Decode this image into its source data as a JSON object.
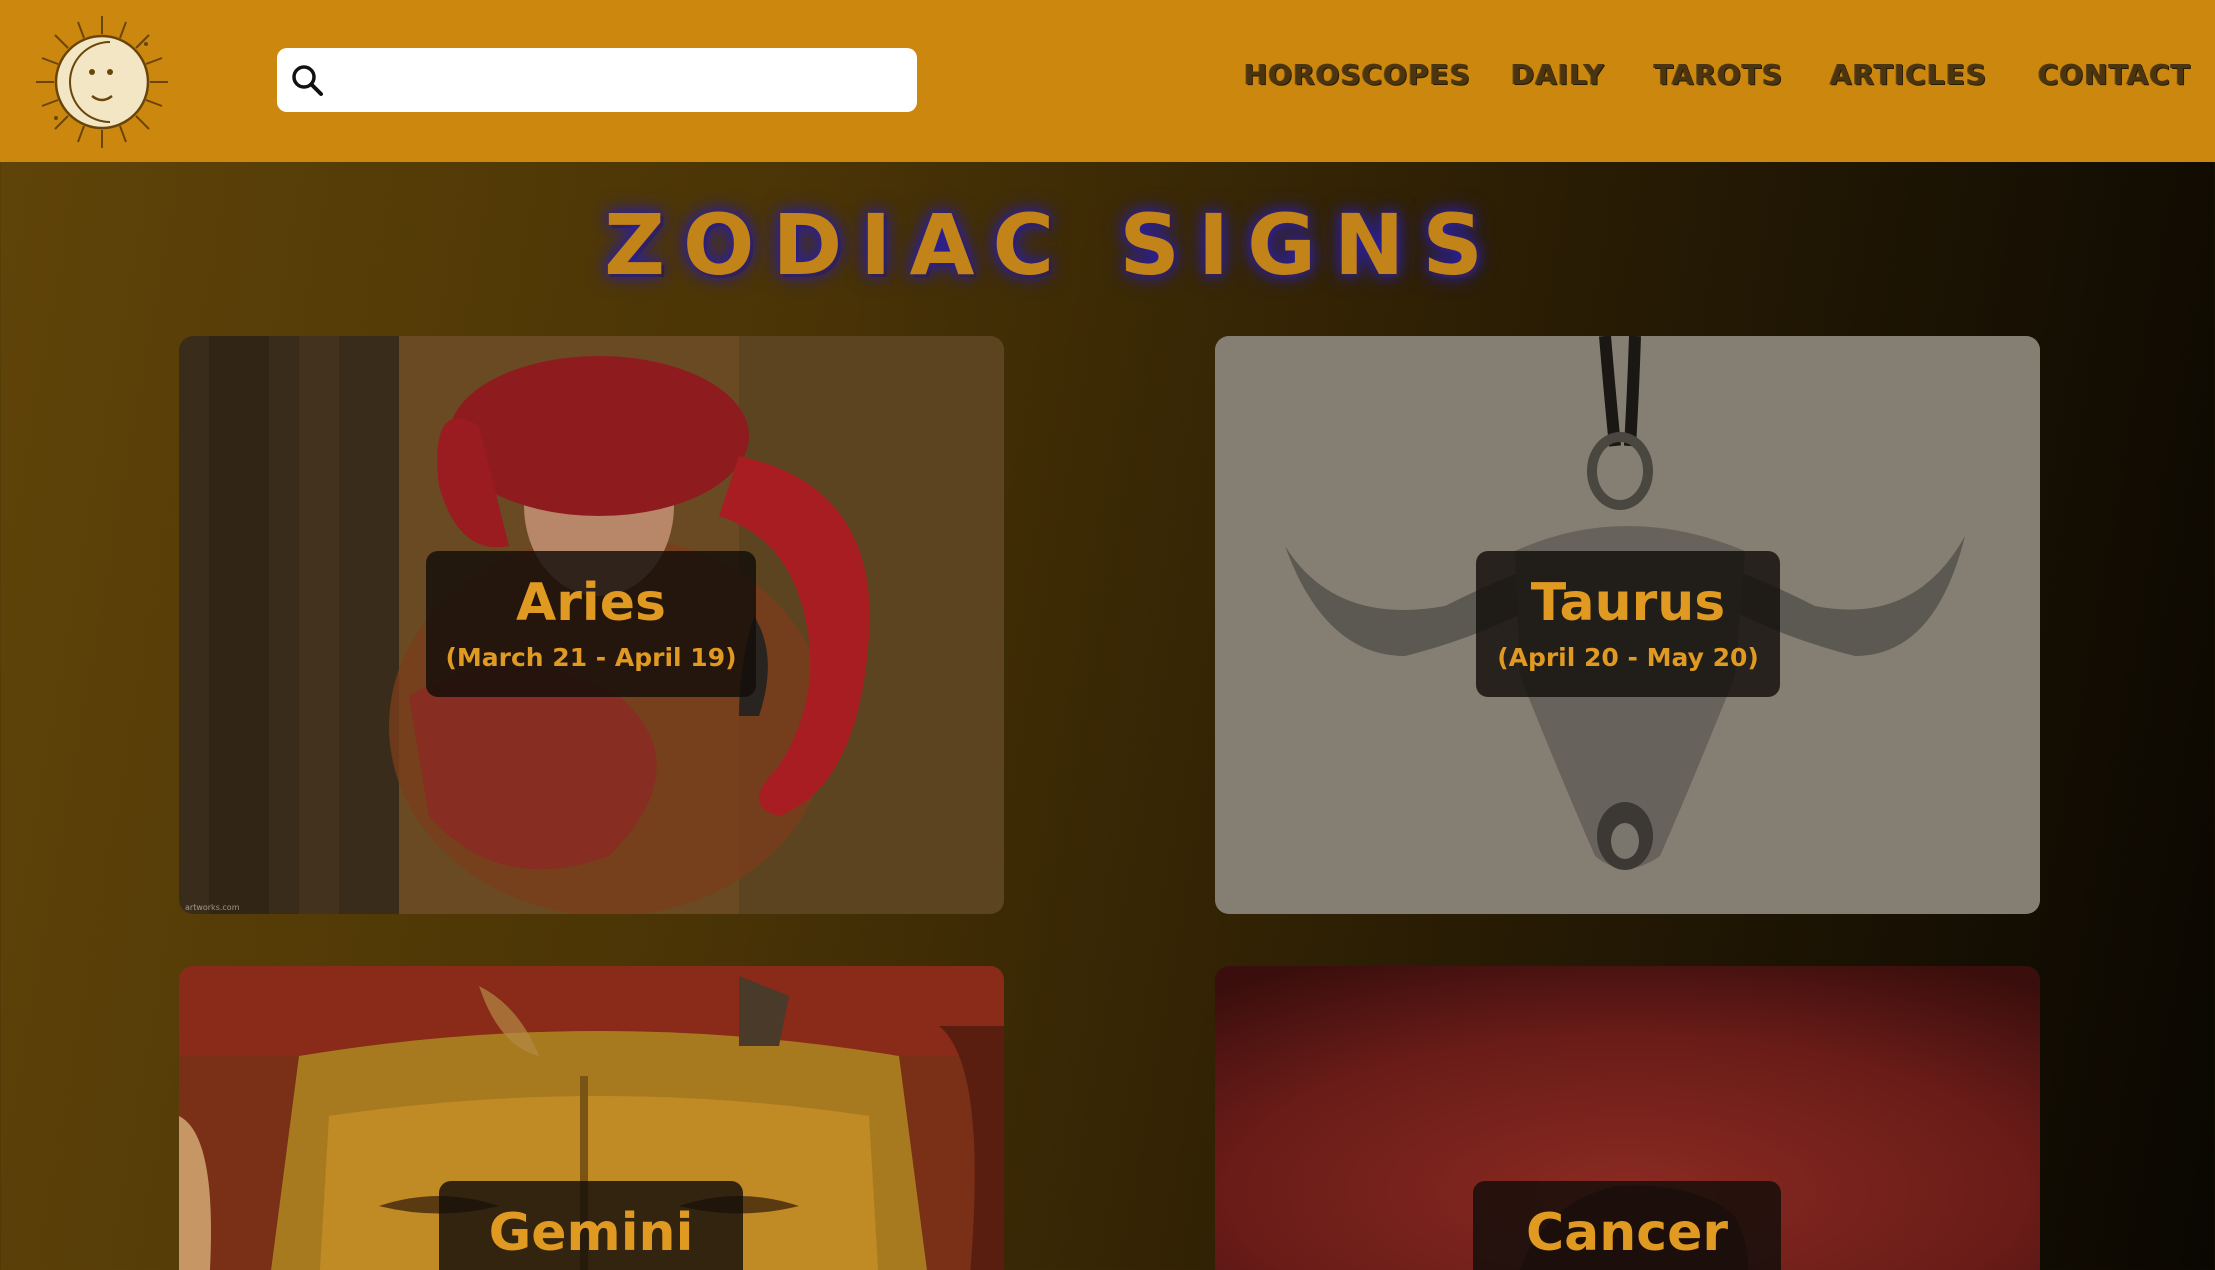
{
  "header": {
    "logo_icon": "sun-moon-logo-icon",
    "search": {
      "icon": "search-icon",
      "value": "",
      "placeholder": ""
    },
    "nav": [
      {
        "label": "HOROSCOPES"
      },
      {
        "label": "DAILY"
      },
      {
        "label": "TAROTS"
      },
      {
        "label": "ARTICLES"
      },
      {
        "label": "CONTACT"
      }
    ]
  },
  "main": {
    "title": "ZODIAC SIGNS",
    "signs": [
      {
        "name": "Aries",
        "dates": "(March 21 - April 19)",
        "watermark": "artworks.com"
      },
      {
        "name": "Taurus",
        "dates": "(April 20 - May 20)"
      },
      {
        "name": "Gemini",
        "dates": ""
      },
      {
        "name": "Cancer",
        "dates": ""
      }
    ]
  },
  "colors": {
    "header_bg": "#cc870f",
    "accent": "#e09a22",
    "nav_text": "#4a3510",
    "title_glow": "#2a1fa0"
  }
}
